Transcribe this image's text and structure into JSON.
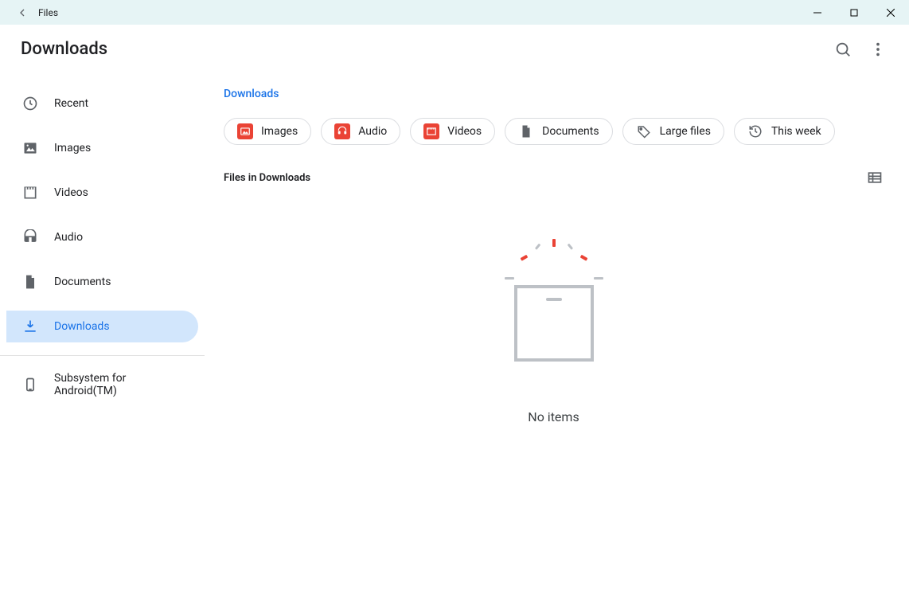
{
  "window": {
    "title": "Files"
  },
  "header": {
    "title": "Downloads"
  },
  "sidebar": {
    "items": [
      {
        "label": "Recent",
        "icon": "recent"
      },
      {
        "label": "Images",
        "icon": "images"
      },
      {
        "label": "Videos",
        "icon": "videos"
      },
      {
        "label": "Audio",
        "icon": "audio"
      },
      {
        "label": "Documents",
        "icon": "documents"
      },
      {
        "label": "Downloads",
        "icon": "downloads",
        "active": true
      }
    ],
    "secondary": [
      {
        "label": "Subsystem for Android(TM)",
        "icon": "device"
      }
    ]
  },
  "breadcrumb": "Downloads",
  "filters": [
    {
      "label": "Images",
      "icon": "images",
      "tint": "red"
    },
    {
      "label": "Audio",
      "icon": "audio",
      "tint": "red"
    },
    {
      "label": "Videos",
      "icon": "videos",
      "tint": "red"
    },
    {
      "label": "Documents",
      "icon": "documents",
      "tint": "plain"
    },
    {
      "label": "Large files",
      "icon": "tag",
      "tint": "plain"
    },
    {
      "label": "This week",
      "icon": "history",
      "tint": "plain"
    }
  ],
  "section": {
    "title": "Files in Downloads"
  },
  "empty": {
    "message": "No items"
  }
}
